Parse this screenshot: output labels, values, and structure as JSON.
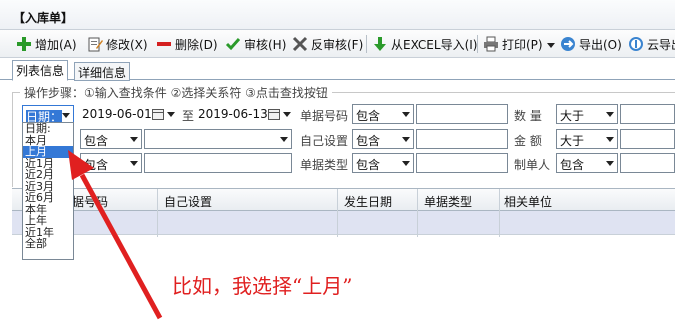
{
  "window": {
    "title": "【入库单】"
  },
  "toolbar": {
    "add": "增加(A)",
    "edit": "修改(X)",
    "delete": "删除(D)",
    "audit": "审核(H)",
    "unaudit": "反审核(F)",
    "import": "从EXCEL导入(I)",
    "print": "打印(P)",
    "export": "导出(O)",
    "cloud": "云导出"
  },
  "tabs": {
    "list": "列表信息",
    "detail": "详细信息"
  },
  "filter": {
    "steps": "操作步骤：①输入查找条件 ②选择关系符 ③点击查找按钮",
    "period_label": "日期：",
    "date_from": "2019-06-01",
    "to": "至",
    "date_to": "2019-06-13",
    "doc_no_label": "单据号码",
    "doc_no_op": "包含",
    "qty_label": "数 量",
    "qty_op": "大于",
    "row2_op": "包含",
    "custom_label": "自己设置",
    "custom_op": "包含",
    "amount_label": "金 额",
    "amount_op": "大于",
    "row3_op": "包含",
    "doc_type_label": "单据类型",
    "doc_type_op": "包含",
    "maker_label": "制单人",
    "maker_op": "包含"
  },
  "grid": {
    "columns": [
      "单据号码",
      "自己设置",
      "发生日期",
      "单据类型",
      "相关单位"
    ],
    "col0_partial": "据号码"
  },
  "dropdown": {
    "options": [
      "日期:",
      "本月",
      "上月",
      "近1月",
      "近2月",
      "近3月",
      "近6月",
      "本年",
      "上年",
      "近1年",
      "全部"
    ],
    "selected": "上月"
  },
  "annotation": "比如，我选择“上月”",
  "colors": {
    "highlight": "#3478d6",
    "annotation": "#e02020",
    "row_selected": "#dfe3f2"
  }
}
